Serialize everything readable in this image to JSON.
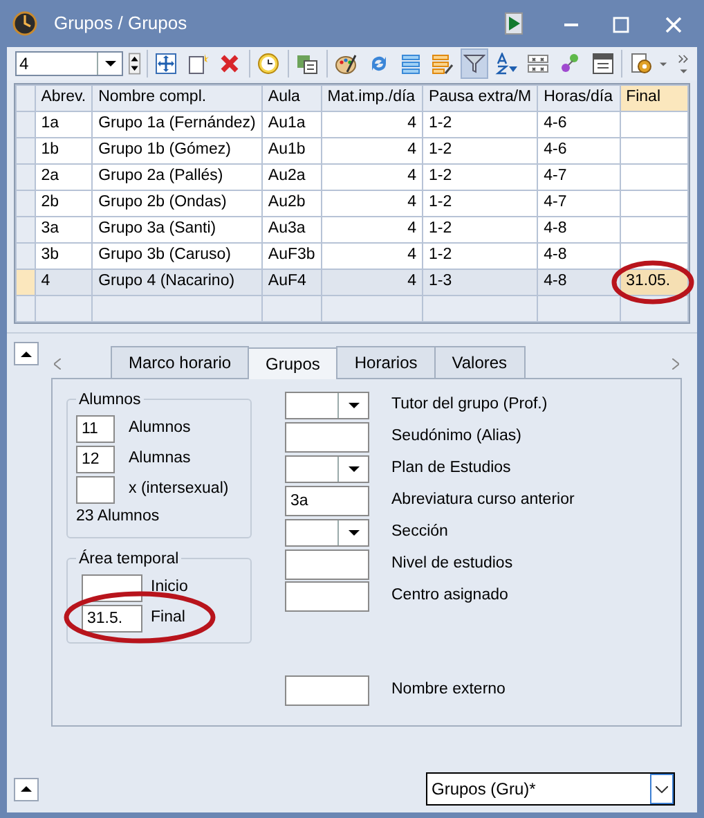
{
  "window": {
    "title": "Grupos / Grupos"
  },
  "toolbar": {
    "selector_value": "4",
    "filter_active": true
  },
  "table": {
    "columns": [
      "Abrev.",
      "Nombre compl.",
      "Aula",
      "Mat.imp./día",
      "Pausa extra/M",
      "Horas/día",
      "Final"
    ],
    "rows": [
      {
        "cells": [
          "1a",
          "Grupo 1a (Fernández)",
          "Au1a",
          "4",
          "1-2",
          "4-6",
          ""
        ],
        "selected": false,
        "circled": false
      },
      {
        "cells": [
          "1b",
          "Grupo 1b (Gómez)",
          "Au1b",
          "4",
          "1-2",
          "4-6",
          ""
        ],
        "selected": false,
        "circled": false
      },
      {
        "cells": [
          "2a",
          "Grupo 2a (Pallés)",
          "Au2a",
          "4",
          "1-2",
          "4-7",
          ""
        ],
        "selected": false,
        "circled": false
      },
      {
        "cells": [
          "2b",
          "Grupo 2b (Ondas)",
          "Au2b",
          "4",
          "1-2",
          "4-7",
          ""
        ],
        "selected": false,
        "circled": false
      },
      {
        "cells": [
          "3a",
          "Grupo 3a (Santi)",
          "Au3a",
          "4",
          "1-2",
          "4-8",
          ""
        ],
        "selected": false,
        "circled": false
      },
      {
        "cells": [
          "3b",
          "Grupo 3b (Caruso)",
          "AuF3b",
          "4",
          "1-2",
          "4-8",
          ""
        ],
        "selected": false,
        "circled": false
      },
      {
        "cells": [
          "4",
          "Grupo 4 (Nacarino)",
          "AuF4",
          "4",
          "1-3",
          "4-8",
          "31.05."
        ],
        "selected": true,
        "circled": true
      }
    ]
  },
  "tabs": [
    {
      "label": "Marco horario",
      "selected": false
    },
    {
      "label": "Grupos",
      "selected": true
    },
    {
      "label": "Horarios",
      "selected": false
    },
    {
      "label": "Valores",
      "selected": false
    }
  ],
  "students": {
    "title": "Alumnos",
    "fields": [
      {
        "value": "11",
        "label": "Alumnos"
      },
      {
        "value": "12",
        "label": "Alumnas"
      },
      {
        "label": "x (intersexual)"
      }
    ],
    "total": "23 Alumnos"
  },
  "time_range": {
    "title": "Área temporal",
    "fields": [
      {
        "label": "Inicio",
        "circled": false
      },
      {
        "value": "31.5.",
        "label": "Final",
        "circled": true
      }
    ]
  },
  "properties": [
    {
      "kind": "dropdown",
      "label": "Tutor del grupo (Prof.)"
    },
    {
      "kind": "text",
      "label": "Seudónimo (Alias)"
    },
    {
      "kind": "dropdown",
      "label": "Plan de Estudios"
    },
    {
      "kind": "text",
      "value": "3a",
      "label": "Abreviatura curso anterior"
    },
    {
      "kind": "dropdown",
      "label": "Sección"
    },
    {
      "kind": "text",
      "label": "Nivel de estudios"
    },
    {
      "kind": "text",
      "label": "Centro asignado"
    },
    {
      "kind": "spacer"
    },
    {
      "kind": "text",
      "label": "Nombre externo"
    }
  ],
  "view_selector": {
    "value": "Grupos (Gru)*"
  }
}
